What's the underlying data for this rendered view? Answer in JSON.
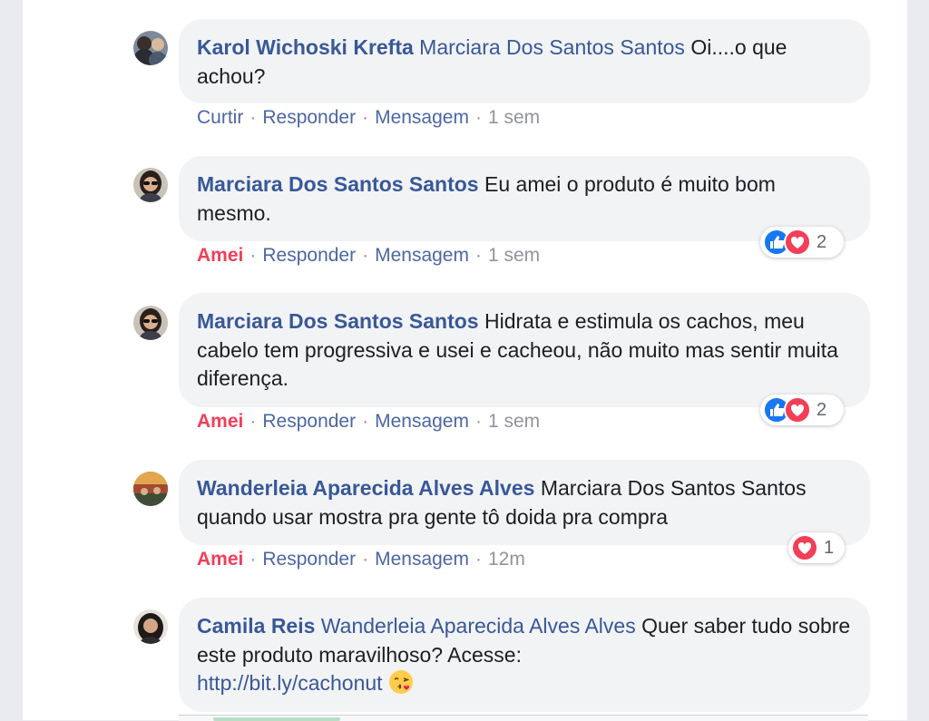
{
  "comments": [
    {
      "author": "Karol Wichoski Krefta",
      "mention": "Marciara Dos Santos Santos",
      "text": " Oi....o que achou?",
      "actions": {
        "like": "Curtir",
        "reply": "Responder",
        "message": "Mensagem",
        "time": "1 sem"
      },
      "liked": false
    },
    {
      "author": "Marciara Dos Santos Santos",
      "text": " Eu amei o produto é muito bom mesmo.",
      "actions": {
        "like": "Amei",
        "reply": "Responder",
        "message": "Mensagem",
        "time": "1 sem"
      },
      "liked": true,
      "reactions": {
        "icons": [
          "like-icon",
          "love-icon"
        ],
        "count": "2"
      }
    },
    {
      "author": "Marciara Dos Santos Santos",
      "text": " Hidrata e estimula os cachos, meu cabelo tem progressiva e usei e cacheou, não muito mas sentir muita diferença.",
      "actions": {
        "like": "Amei",
        "reply": "Responder",
        "message": "Mensagem",
        "time": "1 sem"
      },
      "liked": true,
      "reactions": {
        "icons": [
          "like-icon",
          "love-icon"
        ],
        "count": "2"
      }
    },
    {
      "author": "Wanderleia Aparecida Alves Alves",
      "text": " Marciara Dos Santos Santos quando usar mostra pra gente tô doida pra compra",
      "actions": {
        "like": "Amei",
        "reply": "Responder",
        "message": "Mensagem",
        "time": "12m"
      },
      "liked": true,
      "reactions": {
        "icons": [
          "love-icon"
        ],
        "count": "1"
      }
    },
    {
      "author": "Camila Reis",
      "mention": "Wanderleia Aparecida Alves Alves",
      "text": " Quer saber tudo sobre este produto maravilhoso? Acesse:",
      "link": "http://bit.ly/cachonut",
      "emoji": "kissing-face-icon"
    }
  ],
  "separator": "·",
  "colors": {
    "link_blue": "#385898",
    "action_blue": "#4b67a1",
    "love_red": "#f33e58",
    "like_blue": "#1877f2",
    "bubble_bg": "#f2f3f5"
  }
}
